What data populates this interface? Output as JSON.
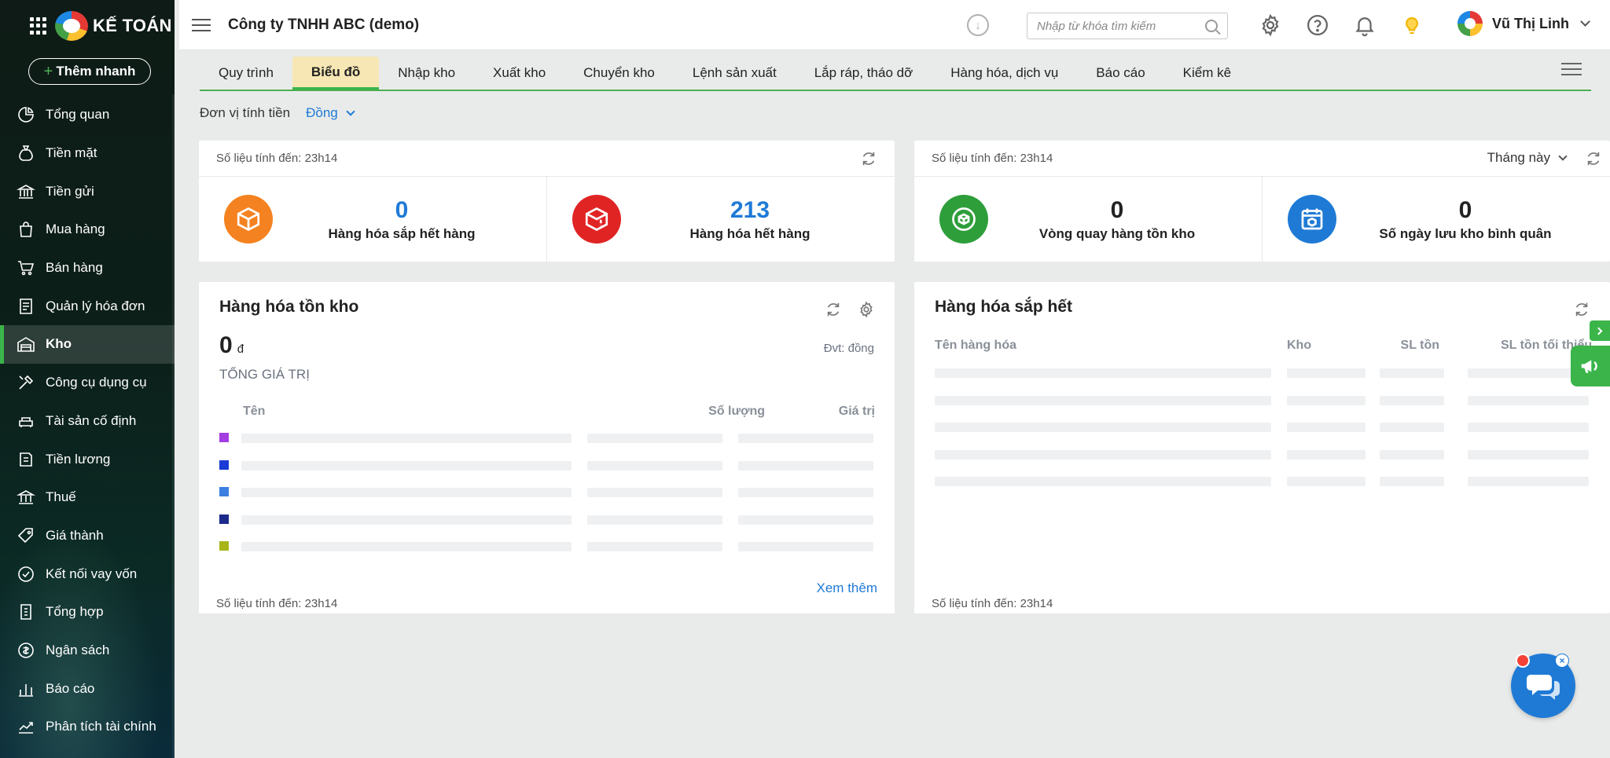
{
  "sidebar": {
    "logo_text": "KẾ TOÁN",
    "quick_add_label": "Thêm nhanh",
    "items": [
      {
        "label": "Tổng quan",
        "icon": "pie-chart-icon"
      },
      {
        "label": "Tiền mặt",
        "icon": "money-bag-icon"
      },
      {
        "label": "Tiền gửi",
        "icon": "bank-icon"
      },
      {
        "label": "Mua hàng",
        "icon": "shopping-bag-icon"
      },
      {
        "label": "Bán hàng",
        "icon": "cart-icon"
      },
      {
        "label": "Quản lý hóa đơn",
        "icon": "invoice-icon"
      },
      {
        "label": "Kho",
        "icon": "warehouse-icon",
        "active": true
      },
      {
        "label": "Công cụ dụng cụ",
        "icon": "tools-icon"
      },
      {
        "label": "Tài sản cố định",
        "icon": "asset-icon"
      },
      {
        "label": "Tiền lương",
        "icon": "salary-icon"
      },
      {
        "label": "Thuế",
        "icon": "tax-icon"
      },
      {
        "label": "Giá thành",
        "icon": "price-tag-icon"
      },
      {
        "label": "Kết nối vay vốn",
        "icon": "loan-icon"
      },
      {
        "label": "Tổng hợp",
        "icon": "summary-icon"
      },
      {
        "label": "Ngân sách",
        "icon": "budget-icon"
      },
      {
        "label": "Báo cáo",
        "icon": "bar-chart-icon"
      },
      {
        "label": "Phân tích tài chính",
        "icon": "trend-icon"
      }
    ]
  },
  "topbar": {
    "company": "Công ty TNHH ABC (demo)",
    "search_placeholder": "Nhập từ khóa tìm kiếm",
    "user_name": "Vũ Thị Linh"
  },
  "tabs": [
    {
      "label": "Quy trình"
    },
    {
      "label": "Biểu đồ",
      "active": true
    },
    {
      "label": "Nhập kho"
    },
    {
      "label": "Xuất kho"
    },
    {
      "label": "Chuyển kho"
    },
    {
      "label": "Lệnh sản xuất"
    },
    {
      "label": "Lắp ráp, tháo dỡ"
    },
    {
      "label": "Hàng hóa, dịch vụ"
    },
    {
      "label": "Báo cáo"
    },
    {
      "label": "Kiểm kê"
    }
  ],
  "currency": {
    "label": "Đơn vị tính tiền",
    "value": "Đồng"
  },
  "stats_left": {
    "updated": "Số liệu tính đến: 23h14",
    "cells": [
      {
        "value": "0",
        "label": "Hàng hóa sắp hết hàng",
        "color": "#f58220"
      },
      {
        "value": "213",
        "label": "Hàng hóa hết hàng",
        "color": "#e02424"
      }
    ]
  },
  "stats_right": {
    "updated": "Số liệu tính đến: 23h14",
    "period": "Tháng này",
    "cells": [
      {
        "value": "0",
        "label": "Vòng quay hàng tồn kho",
        "color": "#2e9e3a"
      },
      {
        "value": "0",
        "label": "Số ngày lưu kho bình quân",
        "color": "#1f7ad6"
      }
    ]
  },
  "inventory_panel": {
    "title": "Hàng hóa tồn kho",
    "total_value": "0",
    "currency_symbol": "đ",
    "total_label": "TỔNG GIÁ TRỊ",
    "unit_note": "Đvt: đồng",
    "columns": [
      "Tên",
      "Số lượng",
      "Giá trị"
    ],
    "swatch_colors": [
      "#a43ee0",
      "#1a3bd6",
      "#3b7fe0",
      "#1c2a8c",
      "#a8b418"
    ],
    "more_link": "Xem thêm",
    "updated": "Số liệu tính đến: 23h14"
  },
  "low_stock_panel": {
    "title": "Hàng hóa sắp hết",
    "columns": [
      "Tên hàng hóa",
      "Kho",
      "SL tồn",
      "SL tồn tối thiểu"
    ],
    "updated": "Số liệu tính đến: 23h14"
  }
}
